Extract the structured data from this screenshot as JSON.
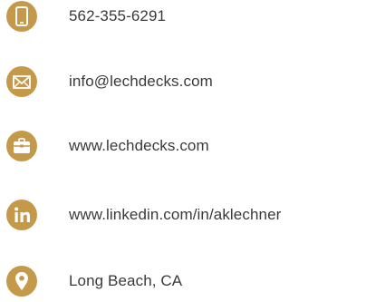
{
  "theme": {
    "badge_color": "#c49a4a",
    "text_color": "#3a3a3a",
    "background": "#ffffff"
  },
  "contacts": [
    {
      "icon": "phone-icon",
      "text": "562-355-6291"
    },
    {
      "icon": "envelope-icon",
      "text": "info@lechdecks.com"
    },
    {
      "icon": "briefcase-icon",
      "text": "www.lechdecks.com"
    },
    {
      "icon": "linkedin-icon",
      "text": "www.linkedin.com/in/aklechner"
    },
    {
      "icon": "map-pin-icon",
      "text": "Long Beach, CA"
    }
  ]
}
